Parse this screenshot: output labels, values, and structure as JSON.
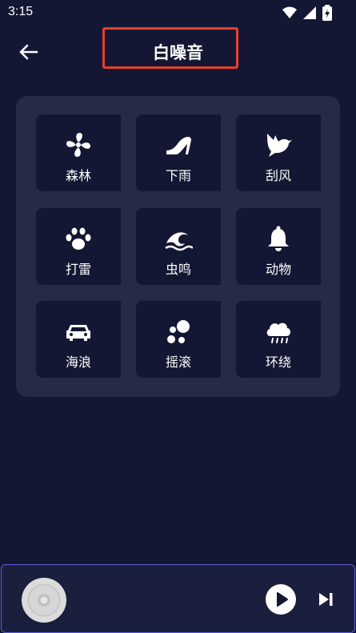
{
  "status_bar": {
    "time": "3:15"
  },
  "header": {
    "title": "白噪音"
  },
  "sounds": [
    {
      "label": "森林",
      "icon": "fan-icon"
    },
    {
      "label": "下雨",
      "icon": "high-heel-icon"
    },
    {
      "label": "刮风",
      "icon": "dove-icon"
    },
    {
      "label": "打雷",
      "icon": "paw-icon"
    },
    {
      "label": "虫鸣",
      "icon": "wave-icon"
    },
    {
      "label": "动物",
      "icon": "bell-icon"
    },
    {
      "label": "海浪",
      "icon": "car-icon"
    },
    {
      "label": "摇滚",
      "icon": "bubbles-icon"
    },
    {
      "label": "环绕",
      "icon": "cloud-rain-icon"
    }
  ],
  "colors": {
    "background": "#141733",
    "panel": "#262a47",
    "highlight_border": "#e5412e",
    "player_border": "#5b5fd9"
  }
}
